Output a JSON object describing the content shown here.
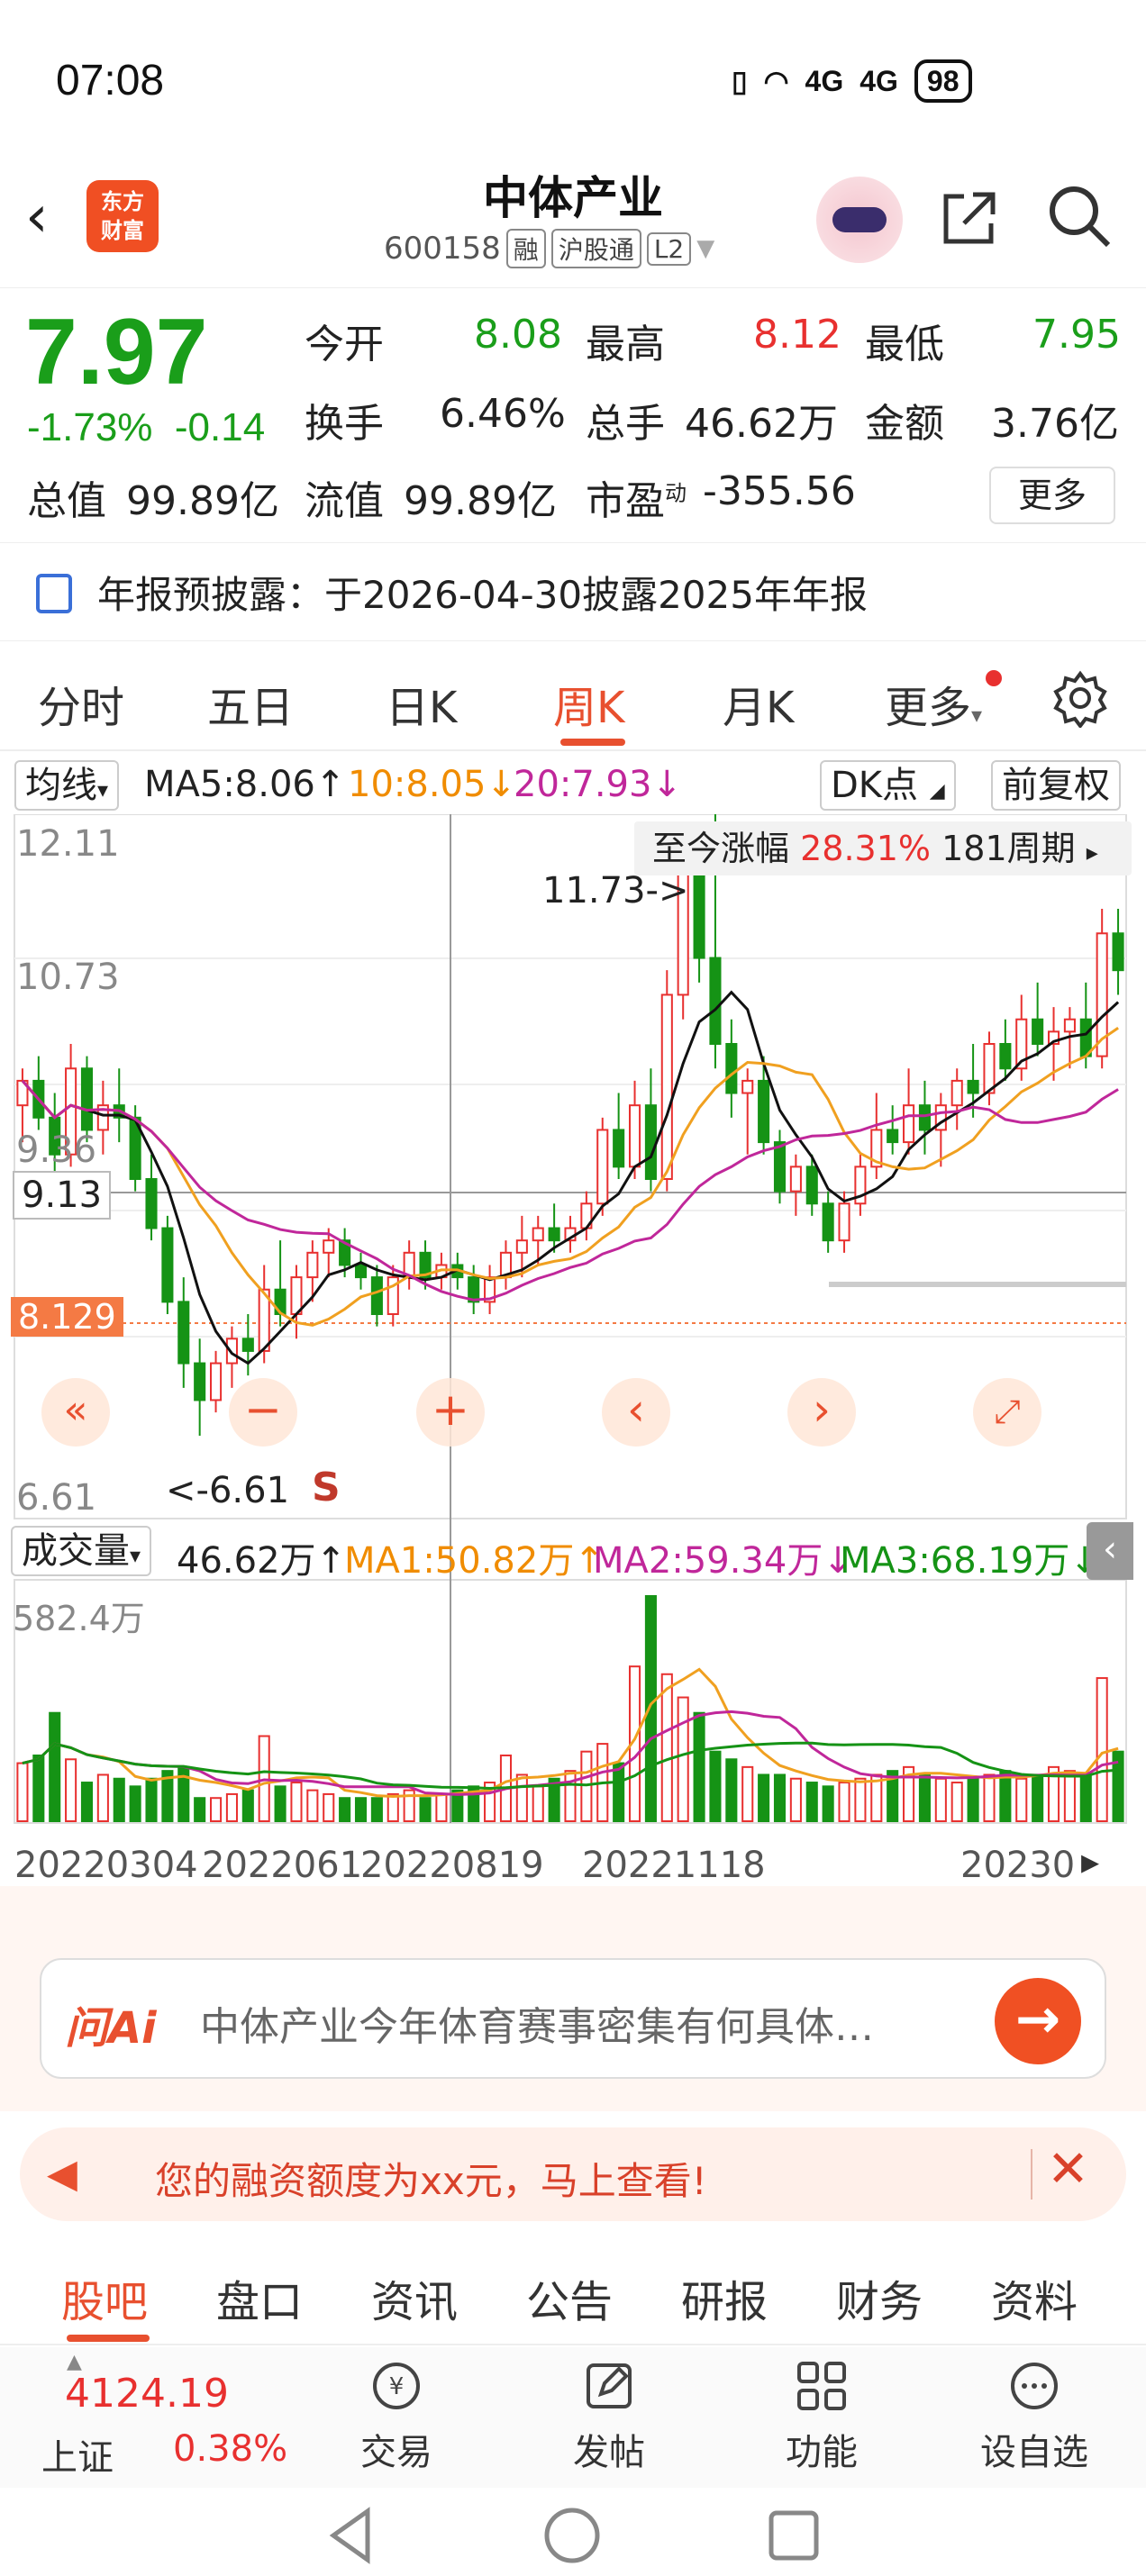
{
  "status": {
    "time": "07:08",
    "network1": "4G",
    "network2": "4G",
    "battery": "98"
  },
  "header": {
    "logo_line1": "东方",
    "logo_line2": "财富",
    "title": "中体产业",
    "code": "600158",
    "tags": [
      "融",
      "沪股通",
      "L2"
    ]
  },
  "quote": {
    "price": "7.97",
    "change_pct": "-1.73%",
    "change": "-0.14",
    "open_label": "今开",
    "open": "8.08",
    "high_label": "最高",
    "high": "8.12",
    "low_label": "最低",
    "low": "7.95",
    "turnover_label": "换手",
    "turnover": "6.46%",
    "volume_label": "总手",
    "volume": "46.62万",
    "amount_label": "金额",
    "amount": "3.76亿",
    "mcap_label": "总值",
    "mcap": "99.89亿",
    "float_label": "流值",
    "float": "99.89亿",
    "pe_label": "市盈",
    "pe_sup": "动",
    "pe": "-355.56",
    "more": "更多"
  },
  "notice": {
    "text": "年报预披露：于2026-04-30披露2025年年报"
  },
  "tabs": [
    "分时",
    "五日",
    "日K",
    "周K",
    "月K",
    "更多"
  ],
  "active_tab": "周K",
  "chart_bar": {
    "ma_btn": "均线",
    "ma5": "MA5:8.06↑",
    "ma10": "10:8.05↓",
    "ma20": "20:7.93↓",
    "dk_btn": "DK点",
    "fq_btn": "前复权"
  },
  "chart_labels": {
    "y_top": "12.11",
    "y_mid1": "10.73",
    "y_mid2": "9.36",
    "y_low": "6.61",
    "crosshair_price": "9.13",
    "current_price": "8.129",
    "gain_label": "至今涨幅",
    "gain": "28.31%",
    "gain_period": "181周期",
    "max_marker": "11.73->",
    "min_marker": "<-6.61",
    "s_marker": "S"
  },
  "volume_bar": {
    "btn": "成交量",
    "vol": "46.62万↑",
    "ma1": "MA1:50.82万↑",
    "ma2": "MA2:59.34万↓",
    "ma3": "MA3:68.19万↓",
    "y_top": "582.4万"
  },
  "dates": [
    "20220304",
    "2022061",
    "20220819",
    "20221118",
    "20230"
  ],
  "chart_data": {
    "type": "candlestick",
    "title": "",
    "ylim": [
      6.61,
      12.11
    ],
    "y_ticks": [
      12.11,
      10.73,
      9.36,
      6.61
    ],
    "candles": [
      [
        9.3,
        9.6,
        9.0,
        9.5
      ],
      [
        9.5,
        9.7,
        9.1,
        9.2
      ],
      [
        9.2,
        9.4,
        8.7,
        8.9
      ],
      [
        8.9,
        9.8,
        8.8,
        9.6
      ],
      [
        9.6,
        9.7,
        9.0,
        9.1
      ],
      [
        9.1,
        9.5,
        8.9,
        9.3
      ],
      [
        9.3,
        9.6,
        9.0,
        9.2
      ],
      [
        9.2,
        9.3,
        8.6,
        8.7
      ],
      [
        8.7,
        8.9,
        8.2,
        8.3
      ],
      [
        8.3,
        8.4,
        7.6,
        7.7
      ],
      [
        7.7,
        7.9,
        7.0,
        7.2
      ],
      [
        7.2,
        7.4,
        6.61,
        6.9
      ],
      [
        6.9,
        7.3,
        6.8,
        7.2
      ],
      [
        7.2,
        7.5,
        7.0,
        7.4
      ],
      [
        7.4,
        7.6,
        7.1,
        7.3
      ],
      [
        7.3,
        8.0,
        7.2,
        7.8
      ],
      [
        7.8,
        8.2,
        7.5,
        7.6
      ],
      [
        7.6,
        8.0,
        7.4,
        7.9
      ],
      [
        7.9,
        8.2,
        7.7,
        8.1
      ],
      [
        8.1,
        8.3,
        7.9,
        8.2
      ],
      [
        8.2,
        8.3,
        7.9,
        8.0
      ],
      [
        8.0,
        8.1,
        7.8,
        7.9
      ],
      [
        7.9,
        8.0,
        7.5,
        7.6
      ],
      [
        7.6,
        8.0,
        7.5,
        7.9
      ],
      [
        7.9,
        8.2,
        7.8,
        8.1
      ],
      [
        8.1,
        8.2,
        7.8,
        7.9
      ],
      [
        7.9,
        8.1,
        7.8,
        8.0
      ],
      [
        8.0,
        8.1,
        7.8,
        7.9
      ],
      [
        7.9,
        8.0,
        7.6,
        7.7
      ],
      [
        7.7,
        8.0,
        7.6,
        7.9
      ],
      [
        7.9,
        8.2,
        7.8,
        8.1
      ],
      [
        8.1,
        8.4,
        7.9,
        8.2
      ],
      [
        8.2,
        8.4,
        8.0,
        8.3
      ],
      [
        8.3,
        8.5,
        8.1,
        8.2
      ],
      [
        8.2,
        8.4,
        8.1,
        8.3
      ],
      [
        8.3,
        8.6,
        8.2,
        8.5
      ],
      [
        8.5,
        9.2,
        8.4,
        9.1
      ],
      [
        9.1,
        9.4,
        8.7,
        8.8
      ],
      [
        8.8,
        9.5,
        8.7,
        9.3
      ],
      [
        9.3,
        9.6,
        8.6,
        8.7
      ],
      [
        8.7,
        10.4,
        8.6,
        10.2
      ],
      [
        10.2,
        11.5,
        10.0,
        11.2
      ],
      [
        11.2,
        11.5,
        10.3,
        10.5
      ],
      [
        10.5,
        11.73,
        9.6,
        9.8
      ],
      [
        9.8,
        10.0,
        9.2,
        9.4
      ],
      [
        9.4,
        9.6,
        8.9,
        9.5
      ],
      [
        9.5,
        9.7,
        8.9,
        9.0
      ],
      [
        9.0,
        9.1,
        8.5,
        8.6
      ],
      [
        8.6,
        8.9,
        8.4,
        8.8
      ],
      [
        8.8,
        8.9,
        8.4,
        8.5
      ],
      [
        8.5,
        8.6,
        8.1,
        8.2
      ],
      [
        8.2,
        8.6,
        8.1,
        8.5
      ],
      [
        8.5,
        8.9,
        8.4,
        8.8
      ],
      [
        8.8,
        9.4,
        8.7,
        9.1
      ],
      [
        9.1,
        9.3,
        8.9,
        9.0
      ],
      [
        9.0,
        9.6,
        8.9,
        9.3
      ],
      [
        9.3,
        9.5,
        8.9,
        9.1
      ],
      [
        9.1,
        9.4,
        8.8,
        9.3
      ],
      [
        9.3,
        9.6,
        9.1,
        9.5
      ],
      [
        9.5,
        9.8,
        9.2,
        9.4
      ],
      [
        9.4,
        9.9,
        9.3,
        9.8
      ],
      [
        9.8,
        10.0,
        9.5,
        9.6
      ],
      [
        9.6,
        10.2,
        9.5,
        10.0
      ],
      [
        10.0,
        10.3,
        9.7,
        9.8
      ],
      [
        9.8,
        10.1,
        9.5,
        9.9
      ],
      [
        9.9,
        10.1,
        9.6,
        10.0
      ],
      [
        10.0,
        10.3,
        9.6,
        9.7
      ],
      [
        9.7,
        10.9,
        9.6,
        10.7
      ],
      [
        10.7,
        10.9,
        10.2,
        10.4
      ]
    ],
    "volumes": [
      150,
      170,
      280,
      160,
      100,
      120,
      110,
      90,
      110,
      130,
      140,
      60,
      60,
      70,
      80,
      220,
      90,
      100,
      80,
      70,
      60,
      60,
      60,
      70,
      80,
      60,
      70,
      80,
      90,
      100,
      170,
      120,
      90,
      110,
      130,
      180,
      200,
      150,
      400,
      582,
      380,
      320,
      280,
      180,
      160,
      140,
      120,
      120,
      110,
      100,
      90,
      100,
      110,
      120,
      130,
      140,
      120,
      110,
      100,
      110,
      120,
      130,
      110,
      120,
      140,
      130,
      120,
      370,
      180
    ],
    "ma_volume": {
      "MA1": 50.82,
      "MA2": 59.34,
      "MA3": 68.19
    },
    "ma_price": {
      "MA5": 8.06,
      "MA10": 8.05,
      "MA20": 7.93
    },
    "x_labels": [
      "20220304",
      "2022061",
      "20220819",
      "20221118",
      "20230"
    ],
    "colors": {
      "up": "#e8302f",
      "down": "#159315",
      "ma5": "#111111",
      "ma10": "#f0a020",
      "ma20": "#c0279a"
    }
  },
  "ask": {
    "logo": "问Ai",
    "placeholder": "中体产业今年体育赛事密集有何具体…"
  },
  "promo": {
    "text": "您的融资额度为xx元，马上查看!"
  },
  "bottom_tabs": [
    "股吧",
    "盘口",
    "资讯",
    "公告",
    "研报",
    "财务",
    "资料"
  ],
  "nav": {
    "index_value": "4124.19",
    "index_name": "上证",
    "index_pct": "0.38%",
    "items": [
      "交易",
      "发帖",
      "功能",
      "设自选"
    ]
  }
}
